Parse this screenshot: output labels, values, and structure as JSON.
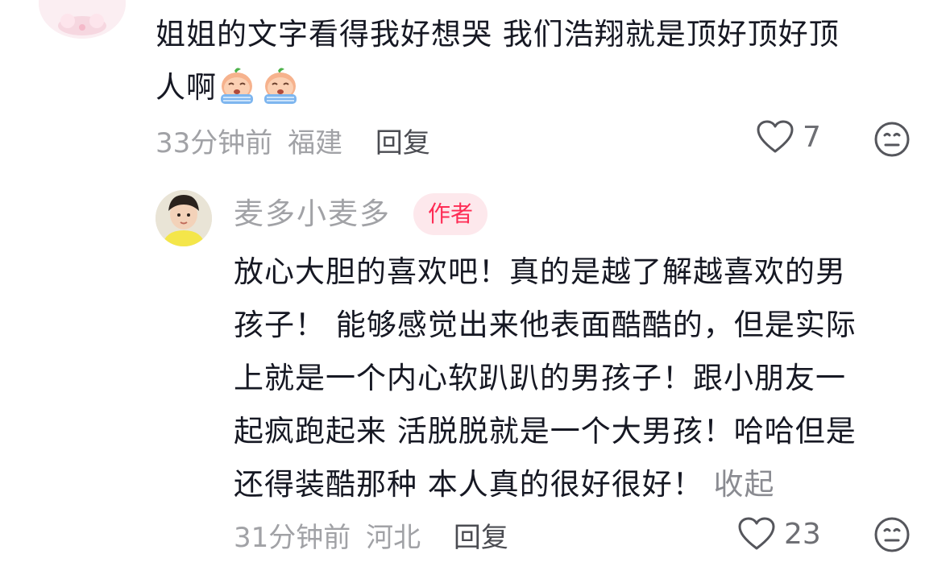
{
  "comment1": {
    "text_line1": "姐姐的文字看得我好想哭 我们浩翔就是顶好顶好顶",
    "text_line2": "人啊",
    "time": "33分钟前",
    "location": "福建",
    "reply_label": "回复",
    "like_count": "7",
    "emojis": [
      "crying-emoji",
      "crying-emoji"
    ]
  },
  "reply1": {
    "username": "麦多小麦多",
    "badge": "作者",
    "lines": [
      "放心大胆的喜欢吧！真的是越了解越喜欢的男",
      "孩子！ 能够感觉出来他表面酷酷的，但是实际",
      "上就是一个内心软趴趴的男孩子！跟小朋友一",
      "起疯跑起来 活脱脱就是一个大男孩！哈哈但是",
      "还得装酷那种  本人真的很好很好！"
    ],
    "collapse_label": "收起",
    "time": "31分钟前",
    "location": "河北",
    "reply_label": "回复",
    "like_count": "23"
  },
  "icons": {
    "like": "heart-outline-icon",
    "dislike": "neutral-face-icon"
  },
  "colors": {
    "text": "#161823",
    "meta": "#a1a2a6",
    "badge_bg": "#fde8ec",
    "badge_text": "#fe2c55"
  }
}
